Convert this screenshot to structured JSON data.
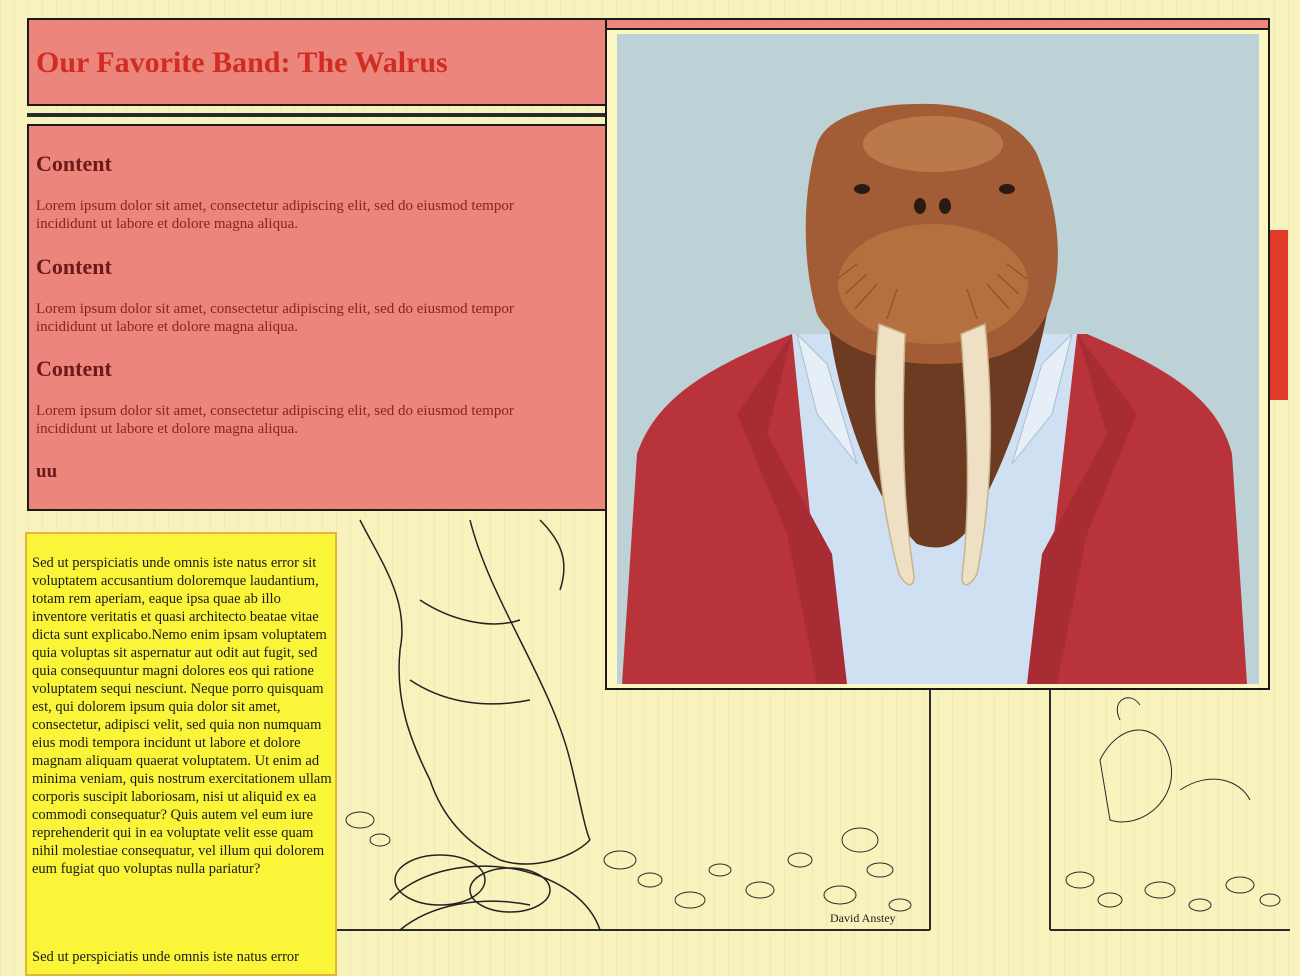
{
  "header": {
    "title": "Our Favorite Band: The Walrus"
  },
  "content": {
    "sections": [
      {
        "heading": "Content",
        "body": "Lorem ipsum dolor sit amet, consectetur adipiscing elit, sed do eiusmod tempor incididunt ut labore et dolore magna aliqua."
      },
      {
        "heading": "Content",
        "body": "Lorem ipsum dolor sit amet, consectetur adipiscing elit, sed do eiusmod tempor incididunt ut labore et dolore magna aliqua."
      },
      {
        "heading": "Content",
        "body": "Lorem ipsum dolor sit amet, consectetur adipiscing elit, sed do eiusmod tempor incididunt ut labore et dolore magna aliqua."
      }
    ],
    "subheading": "uu"
  },
  "sidebar": {
    "paragraphs": [
      "Sed ut perspiciatis unde omnis iste natus error sit voluptatem accusantium doloremque laudantium, totam rem aperiam, eaque ipsa quae ab illo inventore veritatis et quasi architecto beatae vitae dicta sunt explicabo.Nemo enim ipsam voluptatem quia voluptas sit aspernatur aut odit aut fugit, sed quia consequuntur magni dolores eos qui ratione voluptatem sequi nesciunt. Neque porro quisquam est, qui dolorem ipsum quia dolor sit amet, consectetur, adipisci velit, sed quia non numquam eius modi tempora incidunt ut labore et dolore magnam aliquam quaerat voluptatem. Ut enim ad minima veniam, quis nostrum exercitationem ullam corporis suscipit laboriosam, nisi ut aliquid ex ea commodi consequatur? Quis autem vel eum iure reprehenderit qui in ea voluptate velit esse quam nihil molestiae consequatur, vel illum qui dolorem eum fugiat quo voluptas nulla pariatur?",
      "Sed ut perspiciatis unde omnis iste natus error"
    ]
  },
  "illustration": {
    "signature": "David Anstey"
  },
  "colors": {
    "page_background": "#fbf6c2",
    "panel_salmon": "#ec857b",
    "title_red": "#d02c24",
    "heading_dark_red": "#6b1a18",
    "sidebar_yellow": "#fbf53a",
    "photo_background": "#bcd2d6",
    "jacket_red": "#b8343a",
    "shirt_blue": "#cfe0f2"
  }
}
